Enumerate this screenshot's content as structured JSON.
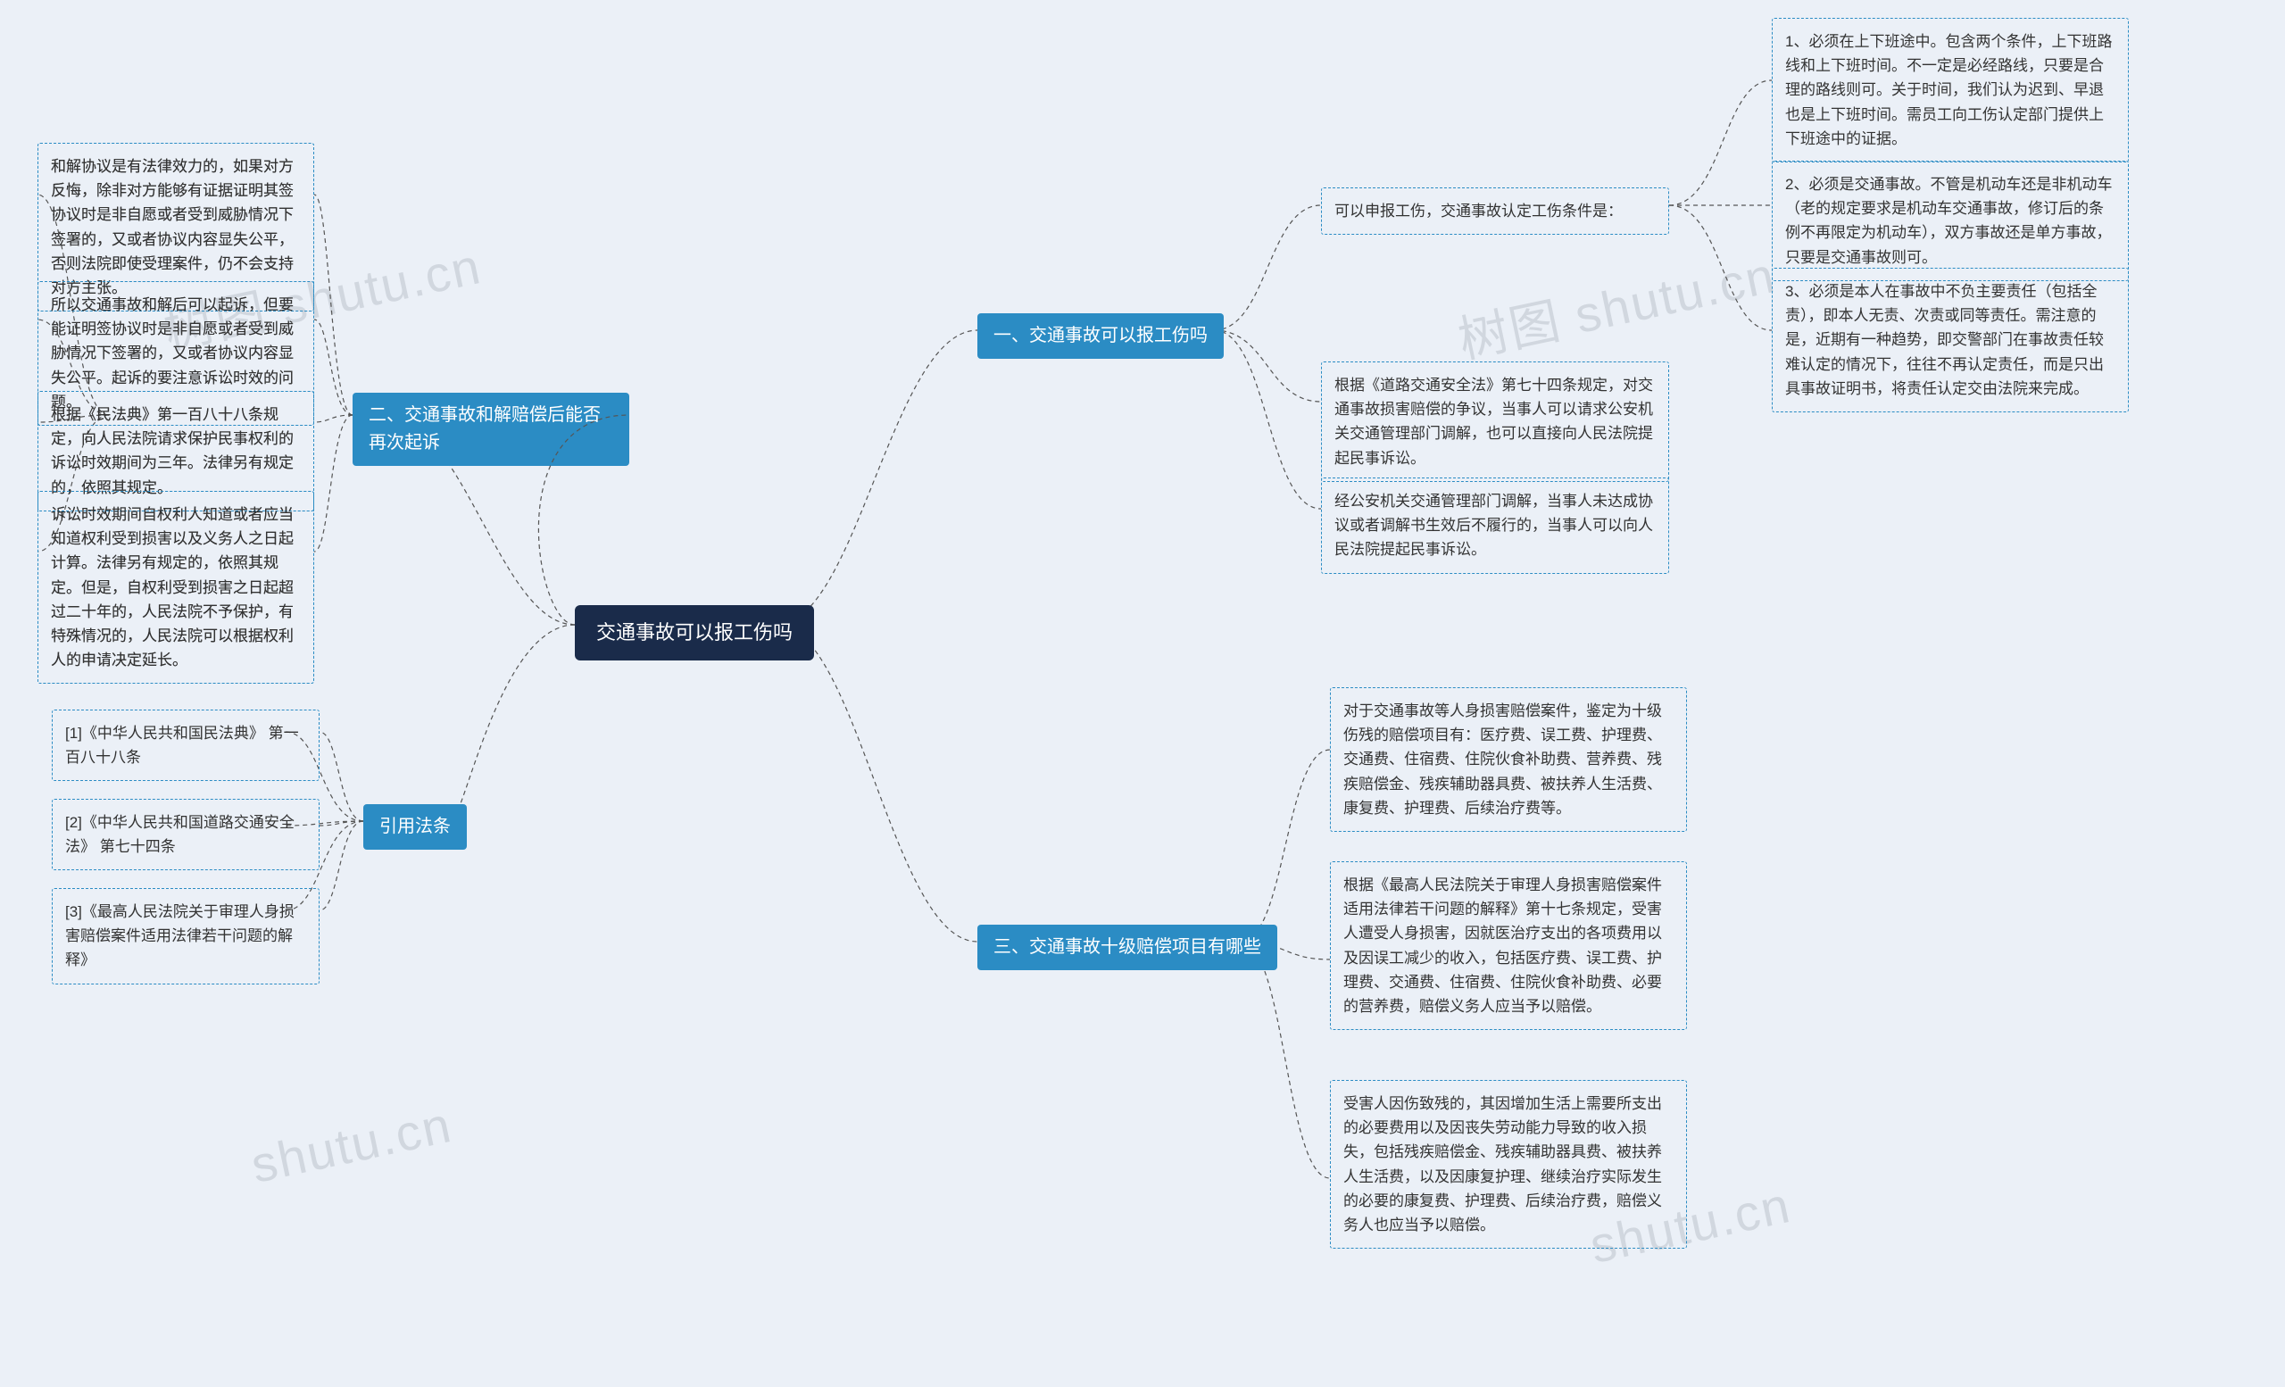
{
  "watermarks": [
    "shutu.cn",
    "树图 shutu.cn",
    "树图 shutu.cn",
    "shutu.cn"
  ],
  "center": {
    "title": "交通事故可以报工伤吗"
  },
  "branches": {
    "b1": {
      "title": "一、交通事故可以报工伤吗",
      "children": {
        "c1": "可以申报工伤，交通事故认定工伤条件是：",
        "c1_1": "1、必须在上下班途中。包含两个条件，上下班路线和上下班时间。不一定是必经路线，只要是合理的路线则可。关于时间，我们认为迟到、早退也是上下班时间。需员工向工伤认定部门提供上下班途中的证据。",
        "c1_2": "2、必须是交通事故。不管是机动车还是非机动车（老的规定要求是机动车交通事故，修订后的条例不再限定为机动车），双方事故还是单方事故，只要是交通事故则可。",
        "c1_3": "3、必须是本人在事故中不负主要责任（包括全责），即本人无责、次责或同等责任。需注意的是，近期有一种趋势，即交警部门在事故责任较难认定的情况下，往往不再认定责任，而是只出具事故证明书，将责任认定交由法院来完成。",
        "c2": "根据《道路交通安全法》第七十四条规定，对交通事故损害赔偿的争议，当事人可以请求公安机关交通管理部门调解，也可以直接向人民法院提起民事诉讼。",
        "c3": "经公安机关交通管理部门调解，当事人未达成协议或者调解书生效后不履行的，当事人可以向人民法院提起民事诉讼。"
      }
    },
    "b2": {
      "title": "二、交通事故和解赔偿后能否再次起诉",
      "children": {
        "c1": "和解协议是有法律效力的，如果对方反悔，除非对方能够有证据证明其签协议时是非自愿或者受到威胁情况下签署的，又或者协议内容显失公平，否则法院即使受理案件，仍不会支持对方主张。",
        "c2": "所以交通事故和解后可以起诉，但要能证明签协议时是非自愿或者受到威胁情况下签署的，又或者协议内容显失公平。起诉的要注意诉讼时效的问题。",
        "c3": "根据《民法典》第一百八十八条规定，向人民法院请求保护民事权利的诉讼时效期间为三年。法律另有规定的，依照其规定。",
        "c4": "诉讼时效期间自权利人知道或者应当知道权利受到损害以及义务人之日起计算。法律另有规定的，依照其规定。但是，自权利受到损害之日起超过二十年的，人民法院不予保护，有特殊情况的，人民法院可以根据权利人的申请决定延长。"
      }
    },
    "b3": {
      "title": "三、交通事故十级赔偿项目有哪些",
      "children": {
        "c1": "对于交通事故等人身损害赔偿案件，鉴定为十级伤残的赔偿项目有：医疗费、误工费、护理费、交通费、住宿费、住院伙食补助费、营养费、残疾赔偿金、残疾辅助器具费、被扶养人生活费、康复费、护理费、后续治疗费等。",
        "c2": "根据《最高人民法院关于审理人身损害赔偿案件适用法律若干问题的解释》第十七条规定，受害人遭受人身损害，因就医治疗支出的各项费用以及因误工减少的收入，包括医疗费、误工费、护理费、交通费、住宿费、住院伙食补助费、必要的营养费，赔偿义务人应当予以赔偿。",
        "c3": "受害人因伤致残的，其因增加生活上需要所支出的必要费用以及因丧失劳动能力导致的收入损失，包括残疾赔偿金、残疾辅助器具费、被扶养人生活费，以及因康复护理、继续治疗实际发生的必要的康复费、护理费、后续治疗费，赔偿义务人也应当予以赔偿。"
      }
    },
    "b4": {
      "title": "引用法条",
      "children": {
        "c1": "[1]《中华人民共和国民法典》 第一百八十八条",
        "c2": "[2]《中华人民共和国道路交通安全法》 第七十四条",
        "c3": "[3]《最高人民法院关于审理人身损害赔偿案件适用法律若干问题的解释》"
      }
    }
  }
}
